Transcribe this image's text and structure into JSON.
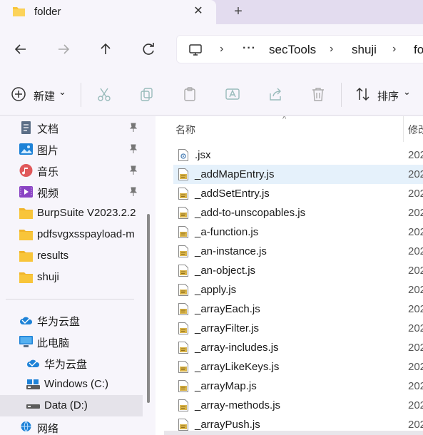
{
  "tab": {
    "title": "folder",
    "close": "✕",
    "new_tab": "+"
  },
  "address": {
    "separator": "›",
    "overflow": "···",
    "crumbs": [
      "secTools",
      "shuji",
      "fo"
    ]
  },
  "commands": {
    "new_label": "新建",
    "sort_label": "排序",
    "chevron": "⌄"
  },
  "sidebar": {
    "items": [
      {
        "label": "文档",
        "icon": "documents-icon",
        "pinned": true
      },
      {
        "label": "图片",
        "icon": "pictures-icon",
        "pinned": true
      },
      {
        "label": "音乐",
        "icon": "music-icon",
        "pinned": true
      },
      {
        "label": "视频",
        "icon": "videos-icon",
        "pinned": true
      },
      {
        "label": "BurpSuite V2023.2.2",
        "icon": "folder-icon"
      },
      {
        "label": "pdfsvgxsspayload-m",
        "icon": "folder-icon"
      },
      {
        "label": "results",
        "icon": "folder-icon"
      },
      {
        "label": "shuji",
        "icon": "folder-icon"
      },
      {
        "label": "华为云盘",
        "icon": "cloud-icon"
      },
      {
        "label": "此电脑",
        "icon": "this-pc-icon"
      },
      {
        "label": "华为云盘",
        "icon": "cloud-icon"
      },
      {
        "label": "Windows (C:)",
        "icon": "drive-icon"
      },
      {
        "label": "Data (D:)",
        "icon": "drive-icon",
        "selected": true
      },
      {
        "label": "网络",
        "icon": "network-icon"
      }
    ]
  },
  "filelist": {
    "col_name": "名称",
    "col_date": "修改",
    "sort_caret": "^",
    "files": [
      {
        "name": ".jsx",
        "date": "202",
        "icon": "config-file-icon"
      },
      {
        "name": "_addMapEntry.js",
        "date": "202",
        "icon": "js-file-icon",
        "hover": true
      },
      {
        "name": "_addSetEntry.js",
        "date": "202",
        "icon": "js-file-icon"
      },
      {
        "name": "_add-to-unscopables.js",
        "date": "202",
        "icon": "js-file-icon"
      },
      {
        "name": "_a-function.js",
        "date": "202",
        "icon": "js-file-icon"
      },
      {
        "name": "_an-instance.js",
        "date": "202",
        "icon": "js-file-icon"
      },
      {
        "name": "_an-object.js",
        "date": "202",
        "icon": "js-file-icon"
      },
      {
        "name": "_apply.js",
        "date": "202",
        "icon": "js-file-icon"
      },
      {
        "name": "_arrayEach.js",
        "date": "202",
        "icon": "js-file-icon"
      },
      {
        "name": "_arrayFilter.js",
        "date": "202",
        "icon": "js-file-icon"
      },
      {
        "name": "_array-includes.js",
        "date": "202",
        "icon": "js-file-icon"
      },
      {
        "name": "_arrayLikeKeys.js",
        "date": "202",
        "icon": "js-file-icon"
      },
      {
        "name": "_arrayMap.js",
        "date": "202",
        "icon": "js-file-icon"
      },
      {
        "name": "_array-methods.js",
        "date": "202",
        "icon": "js-file-icon"
      },
      {
        "name": "_arrayPush.js",
        "date": "202",
        "icon": "js-file-icon"
      }
    ]
  },
  "colors": {
    "accent": "#0067c0",
    "folder": "#f8c53a",
    "selection": "#e5f1fb"
  }
}
